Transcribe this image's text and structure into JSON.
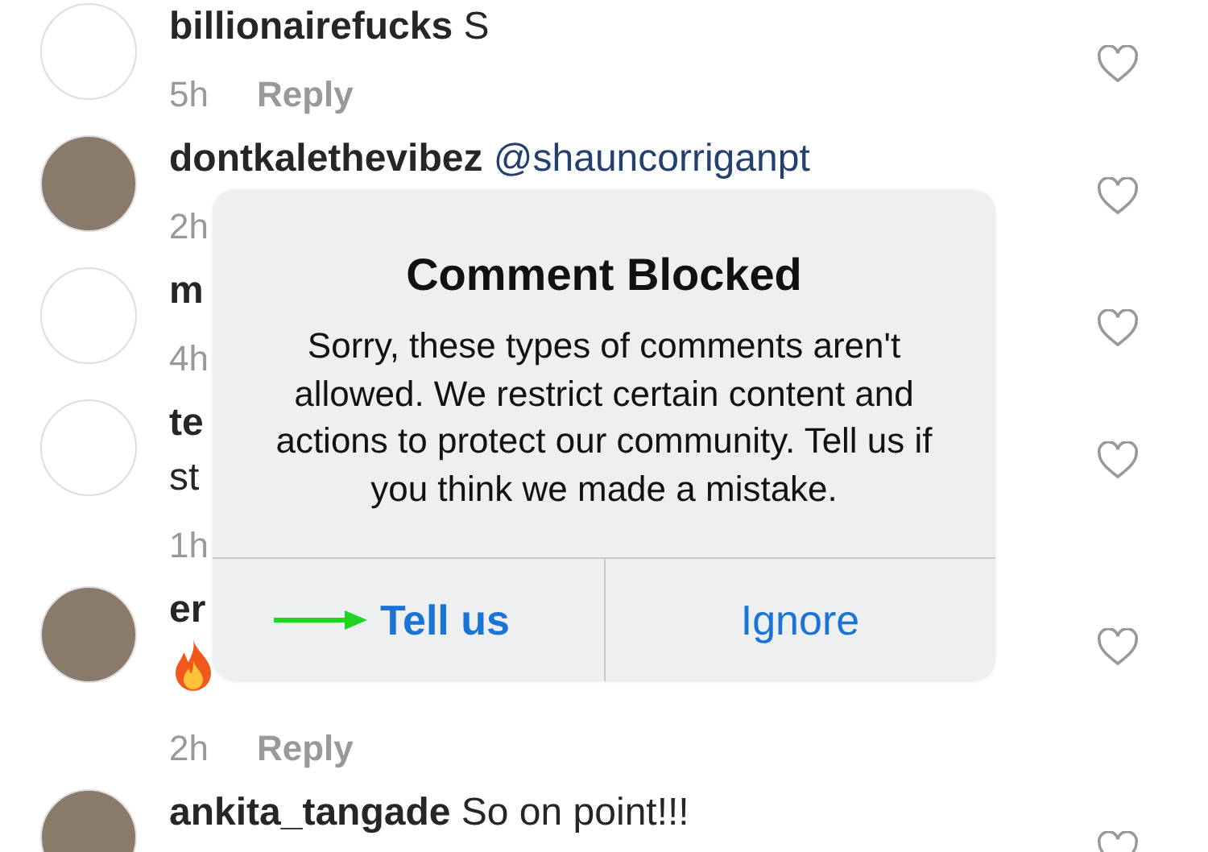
{
  "comments": [
    {
      "kind": "logo",
      "username": "billionairefucks",
      "text": "S",
      "time": "5h",
      "reply": "Reply",
      "reaction_icon": false
    },
    {
      "kind": "photo",
      "username": "dontkalethevibez",
      "mention": "@shauncorriganpt",
      "time": "2h",
      "reaction_icon": false
    },
    {
      "kind": "logo",
      "username": "m",
      "time": "4h",
      "reaction_icon": false
    },
    {
      "kind": "logo",
      "username": "te",
      "line2": "st",
      "time": "1h",
      "reaction_icon": false
    },
    {
      "kind": "photo",
      "username": "er",
      "time": "2h",
      "reply": "Reply",
      "reaction_icon": true
    },
    {
      "kind": "photo",
      "username": "ankita_tangade",
      "text": "So on point!!!",
      "reaction_icon": false
    }
  ],
  "alert": {
    "title": "Comment Blocked",
    "message": "Sorry, these types of comments aren't allowed. We restrict certain content and actions to protect our community. Tell us if you think we made a mistake.",
    "buttons": [
      {
        "label": "Tell us",
        "kind": "primary",
        "arrow": true
      },
      {
        "label": "Ignore",
        "kind": "default",
        "arrow": false
      }
    ]
  }
}
